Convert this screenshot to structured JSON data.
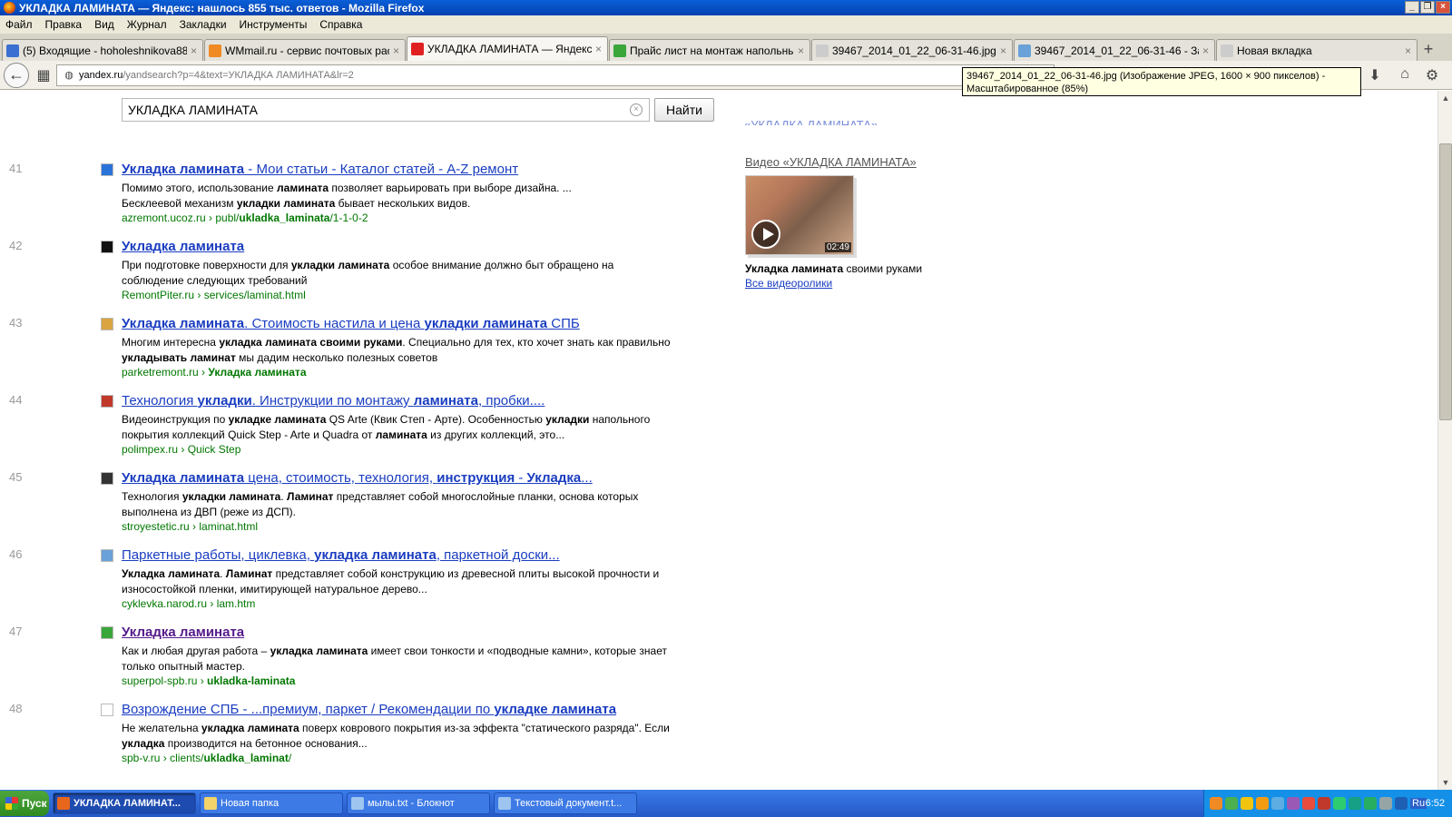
{
  "window": {
    "title": "УКЛАДКА ЛАМИНАТА — Яндекс: нашлось 855 тыс. ответов - Mozilla Firefox"
  },
  "menu": [
    "Файл",
    "Правка",
    "Вид",
    "Журнал",
    "Закладки",
    "Инструменты",
    "Справка"
  ],
  "tabs": [
    {
      "label": "(5) Входящие - hoholeshnikova88...",
      "icon_color": "#3b6fd1",
      "active": false
    },
    {
      "label": "WMmail.ru - сервис почтовых расс...",
      "icon_color": "#f08a24",
      "active": false
    },
    {
      "label": "УКЛАДКА ЛАМИНАТА — Яндекс: ...",
      "icon_color": "#e02020",
      "active": true
    },
    {
      "label": "Прайс лист на монтаж напольных...",
      "icon_color": "#3aa63a",
      "active": false
    },
    {
      "label": "39467_2014_01_22_06-31-46.jpg (...",
      "icon_color": "#cccccc",
      "active": false
    },
    {
      "label": "39467_2014_01_22_06-31-46 - За...",
      "icon_color": "#6aa1d8",
      "active": false
    },
    {
      "label": "Новая вкладка",
      "icon_color": "#cccccc",
      "active": false
    }
  ],
  "newtab_label": "+",
  "url": {
    "domain": "yandex.ru",
    "path": "/yandsearch?p=4&text=УКЛАДКА ЛАМИНАТА&lr=2"
  },
  "tooltip": "39467_2014_01_22_06-31-46.jpg (Изображение JPEG, 1600 × 900 пикселов) - Масштабированное (85%)",
  "search": {
    "query": "УКЛАДКА ЛАМИНАТА",
    "button": "Найти",
    "clear": "×"
  },
  "results": [
    {
      "num": "41",
      "fav_color": "#2a73d9",
      "title_html": "<b>Укладка ламината</b> - Мои статьи - Каталог статей - A-Z ремонт",
      "snippet_html": "Помимо этого, использование <b>ламината</b> позволяет варьировать при выборе дизайна. ...<br>Бесклеевой механизм <b>укладки ламината</b> бывает нескольких видов.",
      "url_html": "azremont.ucoz.ru › publ/<b>ukladka_laminata</b>/1-1-0-2",
      "visited": false
    },
    {
      "num": "42",
      "fav_color": "#111111",
      "title_html": "<b>Укладка ламината</b>",
      "snippet_html": "При подготовке поверхности для <b>укладки ламината</b> особое внимание должно быт обращено на соблюдение следующих требований",
      "url_html": "RemontPiter.ru › services/laminat.html",
      "visited": false
    },
    {
      "num": "43",
      "fav_color": "#d9a441",
      "title_html": "<b>Укладка ламината</b>. Стоимость настила и цена <b>укладки ламината</b> СПБ",
      "snippet_html": "Многим интересна <b>укладка ламината своими руками</b>. Специально для тех, кто хочет знать как правильно <b>укладывать ламинат</b> мы дадим несколько полезных советов",
      "url_html": "parketremont.ru › <b>Укладка ламината</b>",
      "visited": false
    },
    {
      "num": "44",
      "fav_color": "#c0392b",
      "title_html": "Технология <b>укладки</b>. Инструкции по монтажу <b>ламината</b>, пробки....",
      "snippet_html": "Видеоинструкция по <b>укладке ламината</b> QS Arte (Квик Степ - Арте). Особенностью <b>укладки</b> напольного покрытия коллекций Quick Step - Arte и Quadra от <b>ламината</b> из других коллекций, это...",
      "url_html": "polimpex.ru › Quick Step",
      "visited": false
    },
    {
      "num": "45",
      "fav_color": "#333333",
      "title_html": "<b>Укладка ламината</b> цена, стоимость, технология, <b>инструкция</b> - <b>Укладка</b>...",
      "snippet_html": "Технология <b>укладки ламината</b>. <b>Ламинат</b> представляет собой многослойные планки, основа которых выполнена из ДВП (реже из ДСП).",
      "url_html": "stroyestetic.ru › laminat.html",
      "visited": false
    },
    {
      "num": "46",
      "fav_color": "#6aa1d8",
      "title_html": "Паркетные работы, циклевка, <b>укладка ламината</b>, паркетной доски...",
      "snippet_html": "<b>Укладка ламината</b>. <b>Ламинат</b> представляет собой конструкцию из древесной плиты высокой прочности и износостойкой пленки, имитирующей натуральное дерево...",
      "url_html": "cyklevka.narod.ru › lam.htm",
      "visited": false
    },
    {
      "num": "47",
      "fav_color": "#3aa63a",
      "title_html": "<b>Укладка ламината</b>",
      "snippet_html": "Как и любая другая работа – <b>укладка ламината</b> имеет свои тонкости и «подводные камни», которые знает только опытный мастер.",
      "url_html": "superpol-spb.ru › <b>ukladka-laminata</b>",
      "visited": true
    },
    {
      "num": "48",
      "fav_color": "#ffffff",
      "title_html": "Возрождение СПБ - ...премиум, паркет / Рекомендации по <b>укладке ламината</b>",
      "snippet_html": "Не желательна <b>укладка ламината</b> поверх коврового покрытия из-за эффекта \"статического разряда\". Если <b>укладка</b> производится на бетонное основания...",
      "url_html": "spb-v.ru › clients/<b>ukladka_laminat</b>/",
      "visited": false
    }
  ],
  "video": {
    "heading": "Видео «УКЛАДКА ЛАМИНАТА»",
    "duration": "02:49",
    "title_bold": "Укладка ламината",
    "title_rest": " своими руками",
    "all_link": "Все видеоролики",
    "topcut": "«УКЛАДКА ЛАМИНАТА»"
  },
  "taskbar": {
    "start": "Пуск",
    "tasks": [
      {
        "label": "УКЛАДКА ЛАМИНАТ...",
        "icon_color": "#e8661c",
        "active": true
      },
      {
        "label": "Новая папка",
        "icon_color": "#f5d36b",
        "active": false
      },
      {
        "label": "мылы.txt - Блокнот",
        "icon_color": "#9ec5ef",
        "active": false
      },
      {
        "label": "Текстовый документ.t...",
        "icon_color": "#9ec5ef",
        "active": false
      }
    ],
    "tray_colors": [
      "#f08a24",
      "#4caf50",
      "#f1c40f",
      "#f39c12",
      "#5dade2",
      "#9b59b6",
      "#e74c3c",
      "#c0392b",
      "#2ecc71",
      "#16a085",
      "#27ae60",
      "#95a5a6",
      "#1e5fb4"
    ],
    "lang": "Ru",
    "clock": "6:52"
  }
}
